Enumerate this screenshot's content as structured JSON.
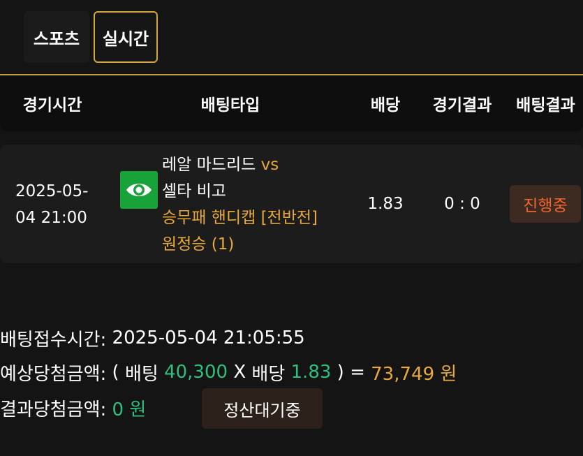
{
  "tabs": {
    "sports": "스포츠",
    "live": "실시간"
  },
  "headers": {
    "time": "경기시간",
    "type": "배팅타입",
    "odds": "배당",
    "result": "경기결과",
    "bet_result": "배팅결과"
  },
  "bet": {
    "date_line1": "2025-05-",
    "date_line2": "04 21:00",
    "eye_icon": "eye-icon",
    "home": "레알 마드리드",
    "vs": "vs",
    "away": "셀타 비고",
    "market_line1": "승무패 핸디캡 [전반전]",
    "market_line2": "원정승 (1)",
    "odds": "1.83",
    "score": "0 : 0",
    "status": "진행중"
  },
  "summary": {
    "received_label": "배팅접수시간:",
    "received_value": "2025-05-04 21:05:55",
    "expected_label": "예상당첨금액:",
    "open_paren": "(",
    "bet_word": "배팅",
    "bet_amount": "40,300",
    "times": "X",
    "odds_word": "배당",
    "odds_value": "1.83",
    "close_eq": ") =",
    "expected_amount": "73,749 원",
    "result_label": "결과당첨금액:",
    "result_amount": "0 원",
    "settle_button": "정산대기중"
  },
  "colors": {
    "accent_gold": "#e8a93a",
    "tab_border": "#d4a640",
    "green": "#2fbf7c",
    "status_orange": "#f0662e",
    "eye_bg": "#1aa23a"
  }
}
